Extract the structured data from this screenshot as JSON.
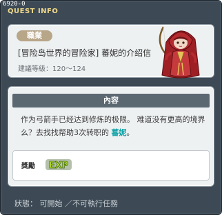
{
  "window": {
    "quest_id": "6920-0",
    "title": "QUEST INFO"
  },
  "quest": {
    "job_badge": "職業",
    "title": "[冒险岛世界的冒险家] 蕃妮的介绍信",
    "level_requirement": "建議等級：120～124"
  },
  "content": {
    "header": "內容",
    "text_part1": "作为弓箭手已经达到修炼的极限。 难道没有更高的境界么？去找找帮助3次转职的 ",
    "npc_name": "蕃妮",
    "text_part2": "。"
  },
  "reward": {
    "label": "獎勵",
    "exp_text": "EXP"
  },
  "status": {
    "text": "狀態： 可開始 ／不可執行任務"
  },
  "colors": {
    "window_bg": "#3d4a55",
    "panel_bg": "#eef1f2",
    "title_gold": "#f1d98a",
    "npc_highlight": "#0fa3a8",
    "exp_green": "#b6e12a",
    "badge_tan": "#b8a689"
  },
  "icons": {
    "portrait": "archer-npc-portrait",
    "exp": "exp-reward-icon"
  }
}
